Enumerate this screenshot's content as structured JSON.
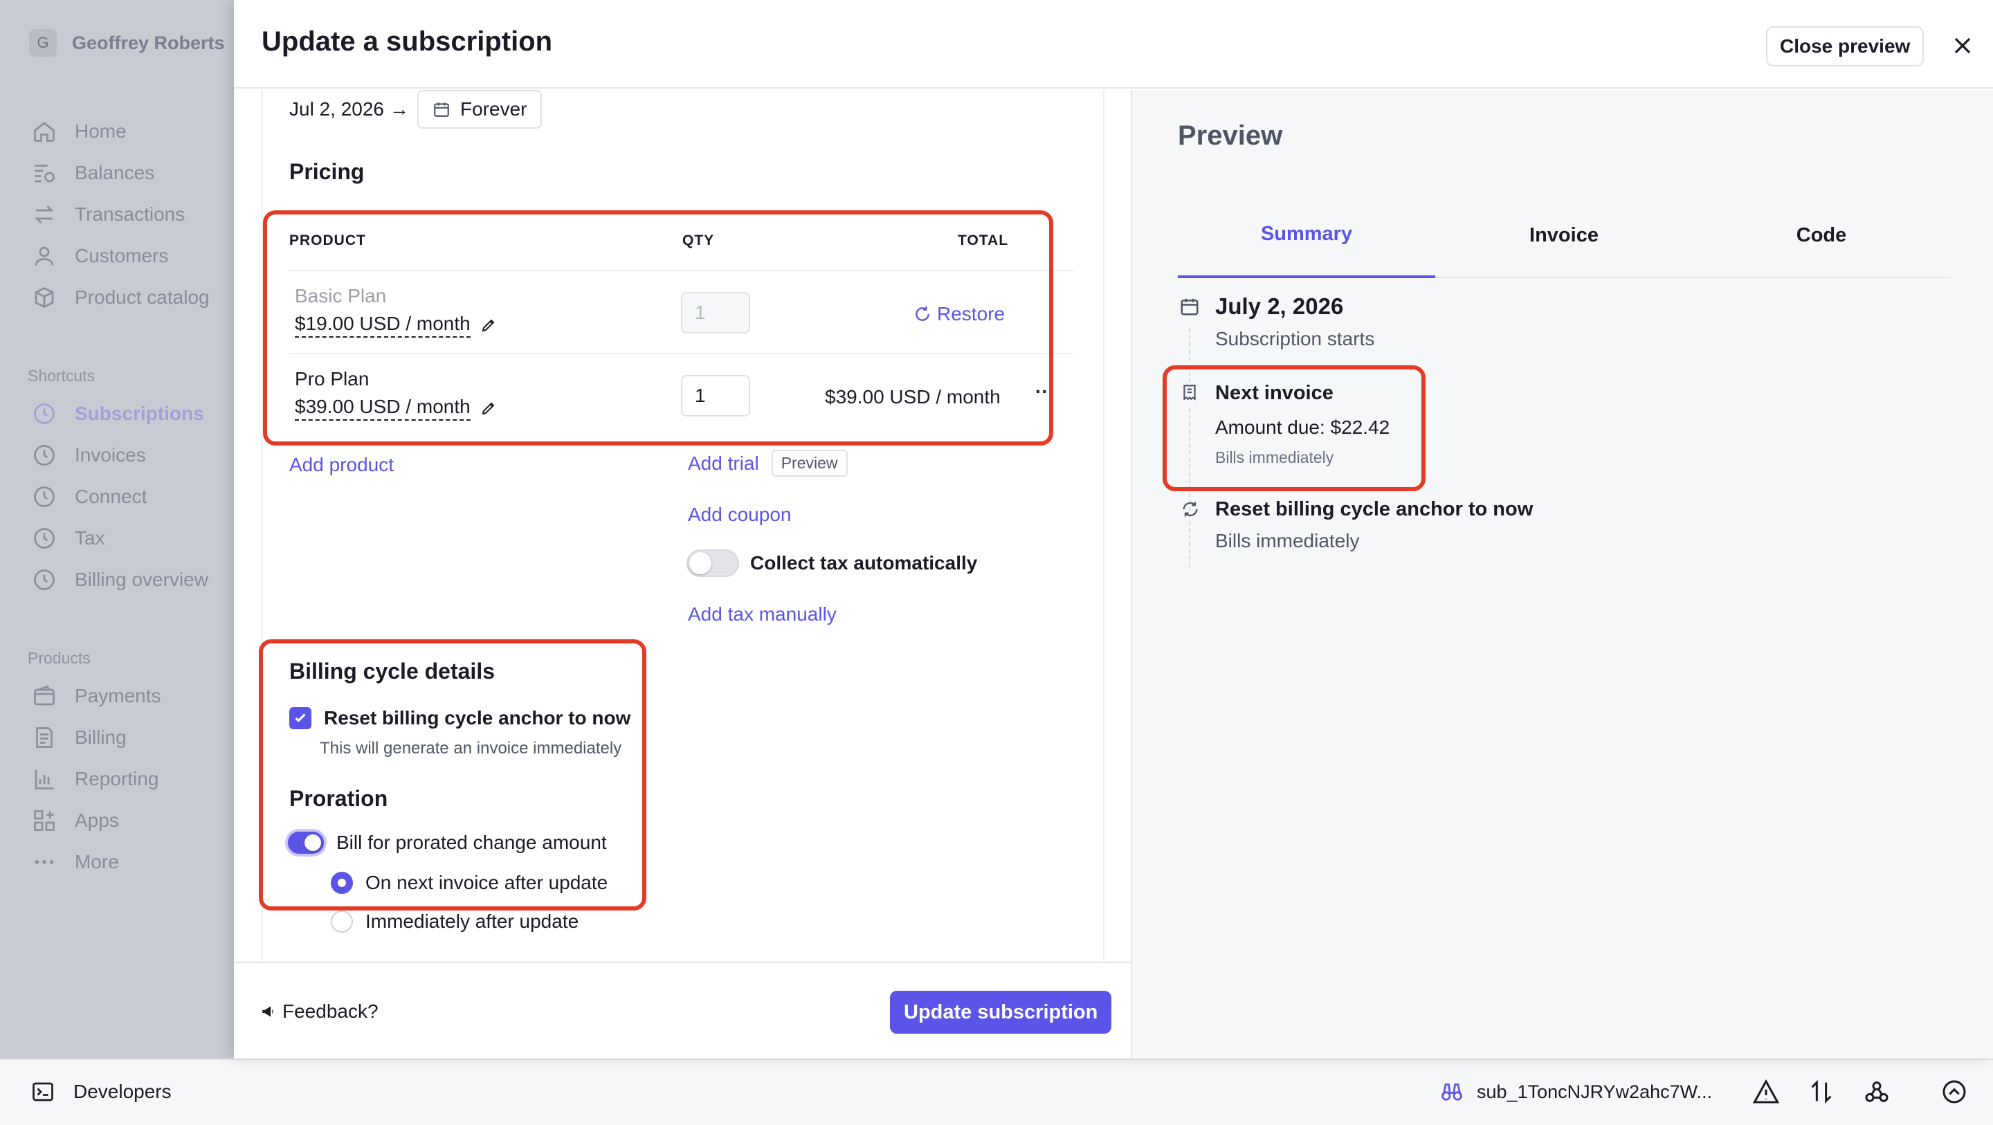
{
  "account": {
    "initial": "G",
    "name": "Geoffrey Roberts"
  },
  "sidebar": {
    "main": [
      "Home",
      "Balances",
      "Transactions",
      "Customers",
      "Product catalog"
    ],
    "shortcuts_heading": "Shortcuts",
    "shortcuts": [
      "Subscriptions",
      "Invoices",
      "Connect",
      "Tax",
      "Billing overview"
    ],
    "products_heading": "Products",
    "products": [
      "Payments",
      "Billing",
      "Reporting",
      "Apps",
      "More"
    ]
  },
  "bottom": {
    "developers": "Developers",
    "subscription_id": "sub_1ToncNJRYw2ahc7W..."
  },
  "modal": {
    "title": "Update a subscription",
    "close_preview": "Close preview"
  },
  "form": {
    "start_date": "Jul 2, 2026",
    "arrow": "→",
    "end_label": "Forever",
    "pricing_heading": "Pricing",
    "columns": {
      "product": "PRODUCT",
      "qty": "QTY",
      "total": "TOTAL"
    },
    "items": [
      {
        "name": "Basic Plan",
        "price": "$19.00 USD / month",
        "qty": "1",
        "action": "Restore"
      },
      {
        "name": "Pro Plan",
        "price": "$39.00 USD / month",
        "qty": "1",
        "total": "$39.00 USD / month",
        "more": "···"
      }
    ],
    "add_product": "Add product",
    "add_trial": "Add trial",
    "preview_badge": "Preview",
    "add_coupon": "Add coupon",
    "collect_tax": "Collect tax automatically",
    "add_tax_manually": "Add tax manually",
    "billing_cycle_heading": "Billing cycle details",
    "reset_anchor_label": "Reset billing cycle anchor to now",
    "reset_anchor_hint": "This will generate an invoice immediately",
    "proration_heading": "Proration",
    "bill_prorated_label": "Bill for prorated change amount",
    "on_next_invoice": "On next invoice after update",
    "immediately_after": "Immediately after update"
  },
  "footer": {
    "feedback": "Feedback?",
    "update_button": "Update subscription"
  },
  "preview": {
    "title": "Preview",
    "tabs": [
      "Summary",
      "Invoice",
      "Code"
    ],
    "start_date": "July 2, 2026",
    "start_sub": "Subscription starts",
    "next_invoice": "Next invoice",
    "amount_due": "Amount due: $22.42",
    "bills_immediately_small": "Bills immediately",
    "reset_title": "Reset billing cycle anchor to now",
    "reset_sub": "Bills immediately"
  },
  "colors": {
    "accent": "#5b54e8",
    "highlight": "#e33b26",
    "sidebar_bg": "#c8cbd2"
  }
}
